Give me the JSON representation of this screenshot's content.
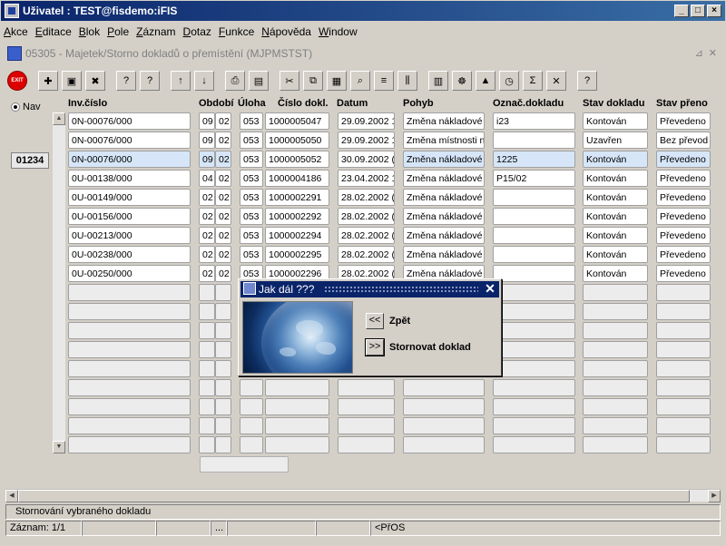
{
  "window": {
    "title": "Uživatel : TEST@fisdemo:iFIS",
    "minimize": "_",
    "maximize": "□",
    "close": "×"
  },
  "menu": [
    "Akce",
    "Editace",
    "Blok",
    "Pole",
    "Záznam",
    "Dotaz",
    "Funkce",
    "Nápověda",
    "Window"
  ],
  "form": {
    "title": "05305 - Majetek/Storno dokladů o přemístění (MJPMSTST)",
    "minimize": "⊿",
    "close": "✕"
  },
  "toolbar": {
    "exit_label": "EXIT"
  },
  "nav": {
    "radio_label": "Nav",
    "count": "01234"
  },
  "columns": {
    "inv": "Inv.číslo",
    "obdobi": "Období",
    "uloha": "Úloha",
    "cislo": "Číslo dokl.",
    "datum": "Datum",
    "pohyb": "Pohyb",
    "oznac": "Označ.dokladu",
    "stav": "Stav dokladu",
    "stavp": "Stav přeno"
  },
  "rows": [
    {
      "inv": "0N-00076/000",
      "o1": "09",
      "o2": "02",
      "uloha": "053",
      "cislo": "1000005047",
      "datum": "29.09.2002 1",
      "pohyb": "Změna nákladové",
      "oznac": "i23",
      "stav": "Kontován",
      "stavp": "Převedeno"
    },
    {
      "inv": "0N-00076/000",
      "o1": "09",
      "o2": "02",
      "uloha": "053",
      "cislo": "1000005050",
      "datum": "29.09.2002 1",
      "pohyb": "Změna místnosti n",
      "oznac": "",
      "stav": "Uzavřen",
      "stavp": "Bez převod"
    },
    {
      "inv": "0N-00076/000",
      "o1": "09",
      "o2": "02",
      "uloha": "053",
      "cislo": "1000005052",
      "datum": "30.09.2002 (",
      "pohyb": "Změna nákladové",
      "oznac": "1225",
      "stav": "Kontován",
      "stavp": "Převedeno"
    },
    {
      "inv": "0U-00138/000",
      "o1": "04",
      "o2": "02",
      "uloha": "053",
      "cislo": "1000004186",
      "datum": "23.04.2002 1",
      "pohyb": "Změna nákladové",
      "oznac": "P15/02",
      "stav": "Kontován",
      "stavp": "Převedeno"
    },
    {
      "inv": "0U-00149/000",
      "o1": "02",
      "o2": "02",
      "uloha": "053",
      "cislo": "1000002291",
      "datum": "28.02.2002 (",
      "pohyb": "Změna nákladové",
      "oznac": "",
      "stav": "Kontován",
      "stavp": "Převedeno"
    },
    {
      "inv": "0U-00156/000",
      "o1": "02",
      "o2": "02",
      "uloha": "053",
      "cislo": "1000002292",
      "datum": "28.02.2002 (",
      "pohyb": "Změna nákladové",
      "oznac": "",
      "stav": "Kontován",
      "stavp": "Převedeno"
    },
    {
      "inv": "0U-00213/000",
      "o1": "02",
      "o2": "02",
      "uloha": "053",
      "cislo": "1000002294",
      "datum": "28.02.2002 (",
      "pohyb": "Změna nákladové",
      "oznac": "",
      "stav": "Kontován",
      "stavp": "Převedeno"
    },
    {
      "inv": "0U-00238/000",
      "o1": "02",
      "o2": "02",
      "uloha": "053",
      "cislo": "1000002295",
      "datum": "28.02.2002 (",
      "pohyb": "Změna nákladové",
      "oznac": "",
      "stav": "Kontován",
      "stavp": "Převedeno"
    },
    {
      "inv": "0U-00250/000",
      "o1": "02",
      "o2": "02",
      "uloha": "053",
      "cislo": "1000002296",
      "datum": "28.02.2002 (",
      "pohyb": "Změna nákladové",
      "oznac": "",
      "stav": "Kontován",
      "stavp": "Převedeno"
    }
  ],
  "empty_row_count": 9,
  "selected_row": 2,
  "dialog": {
    "title": "Jak dál ???",
    "close": "✕",
    "back_button": "<<",
    "back_label": "Zpět",
    "storno_button": ">>",
    "storno_label": "Stornovat doklad"
  },
  "status": {
    "message": "Stornování vybraného dokladu",
    "record": "Záznam: 1/1",
    "seg3": "...",
    "mode": "<PřOS"
  }
}
